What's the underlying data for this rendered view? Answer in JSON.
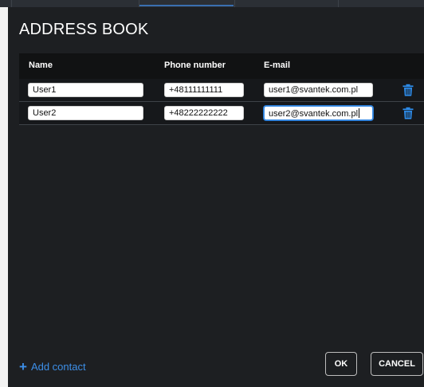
{
  "dialog": {
    "title": "ADDRESS BOOK",
    "columns": {
      "name": "Name",
      "phone": "Phone number",
      "email": "E-mail"
    },
    "contacts": [
      {
        "name": "User1",
        "phone": "+48111111111",
        "email": "user1@svantek.com.pl"
      },
      {
        "name": "User2",
        "phone": "+48222222222",
        "email": "user2@svantek.com.pl"
      }
    ],
    "add_contact_label": "Add contact",
    "ok_label": "OK",
    "cancel_label": "CANCEL"
  },
  "colors": {
    "background": "#1d1f22",
    "accent": "#3d8fe8"
  }
}
